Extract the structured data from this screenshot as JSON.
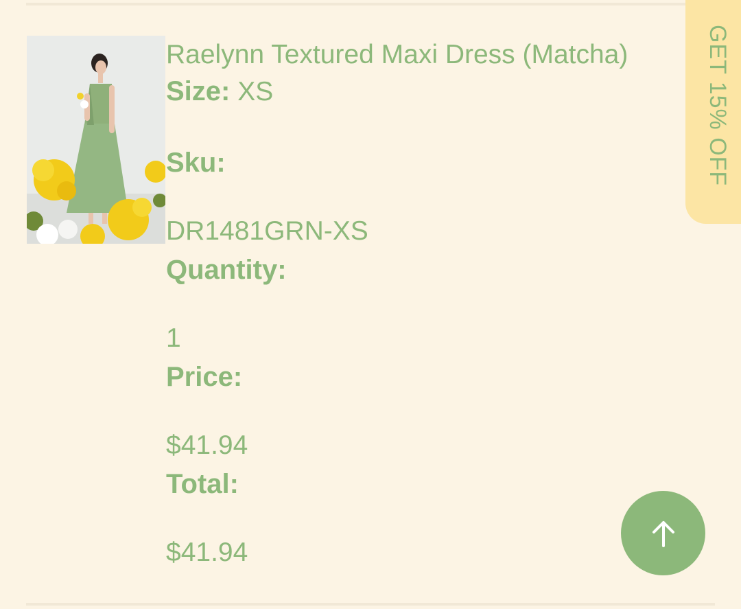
{
  "product": {
    "name": "Raelynn Textured Maxi Dress (Matcha)",
    "image_alt": "Model wearing green maxi dress with yellow flowers",
    "size_label": "Size:",
    "size_value": "XS",
    "sku_label": "Sku:",
    "sku_value": "DR1481GRN-XS",
    "quantity_label": "Quantity:",
    "quantity_value": "1",
    "price_label": "Price:",
    "price_value": "$41.94",
    "total_label": "Total:",
    "total_value": "$41.94"
  },
  "promo": {
    "label": "GET 15% OFF"
  },
  "back_to_top": {
    "icon": "arrow-up-icon"
  },
  "colors": {
    "background": "#fcf4e4",
    "text_green": "#8cb87a",
    "promo_bg": "#fce5a4",
    "button_bg": "#8cb87a"
  }
}
